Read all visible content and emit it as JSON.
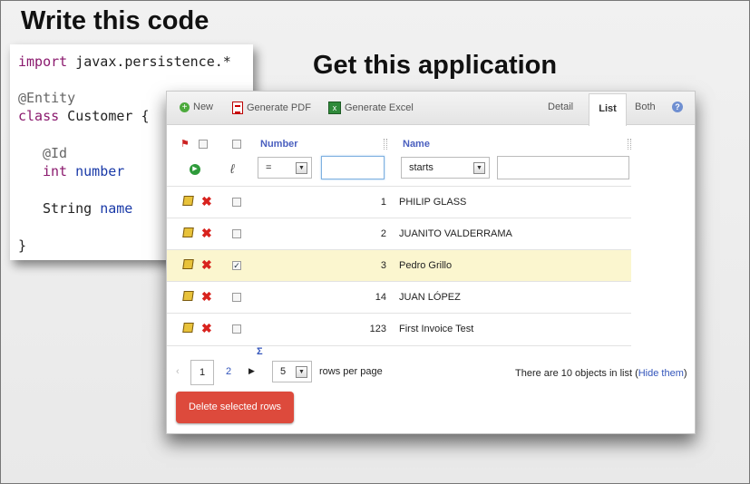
{
  "slide": {
    "title_left": "Write this code",
    "title_right": "Get this application"
  },
  "code": {
    "lines": [
      {
        "kw": "import",
        "rest": " javax.persistence.*"
      },
      {
        "an": "@Entity"
      },
      {
        "kw": "class",
        "rest": " Customer {"
      },
      {
        "an": "@Id"
      },
      {
        "kw": "int",
        "field": " number"
      },
      {
        "plain": "String",
        "field": " name"
      },
      {
        "plain": "}"
      }
    ]
  },
  "toolbar": {
    "new_label": "New",
    "pdf_label": "Generate PDF",
    "excel_label": "Generate Excel",
    "tabs": [
      "Detail",
      "List",
      "Both"
    ],
    "active_tab": "List"
  },
  "table": {
    "columns": [
      "Number",
      "Name"
    ],
    "number_filter": {
      "operator": "=",
      "value": ""
    },
    "name_filter": {
      "operator": "starts",
      "value": ""
    },
    "rows": [
      {
        "number": "1",
        "name": "PHILIP GLASS",
        "checked": false
      },
      {
        "number": "2",
        "name": "JUANITO VALDERRAMA",
        "checked": false
      },
      {
        "number": "3",
        "name": "Pedro Grillo",
        "checked": true
      },
      {
        "number": "14",
        "name": "JUAN LÓPEZ",
        "checked": false
      },
      {
        "number": "123",
        "name": "First Invoice Test",
        "checked": false
      }
    ]
  },
  "pager": {
    "pages": [
      "1",
      "2"
    ],
    "current_page": "1",
    "sum_symbol": "Σ",
    "rows_per_page": "5",
    "rows_per_page_label": "rows per page",
    "count_text": "There are 10 objects in list (",
    "hide_link": "Hide them",
    "count_close": ")"
  },
  "actions": {
    "delete_selected": "Delete selected rows"
  },
  "colors": {
    "highlight_row": "#fbf6cf",
    "delete_button": "#dd4a3c",
    "column_header": "#4a5fbf"
  }
}
